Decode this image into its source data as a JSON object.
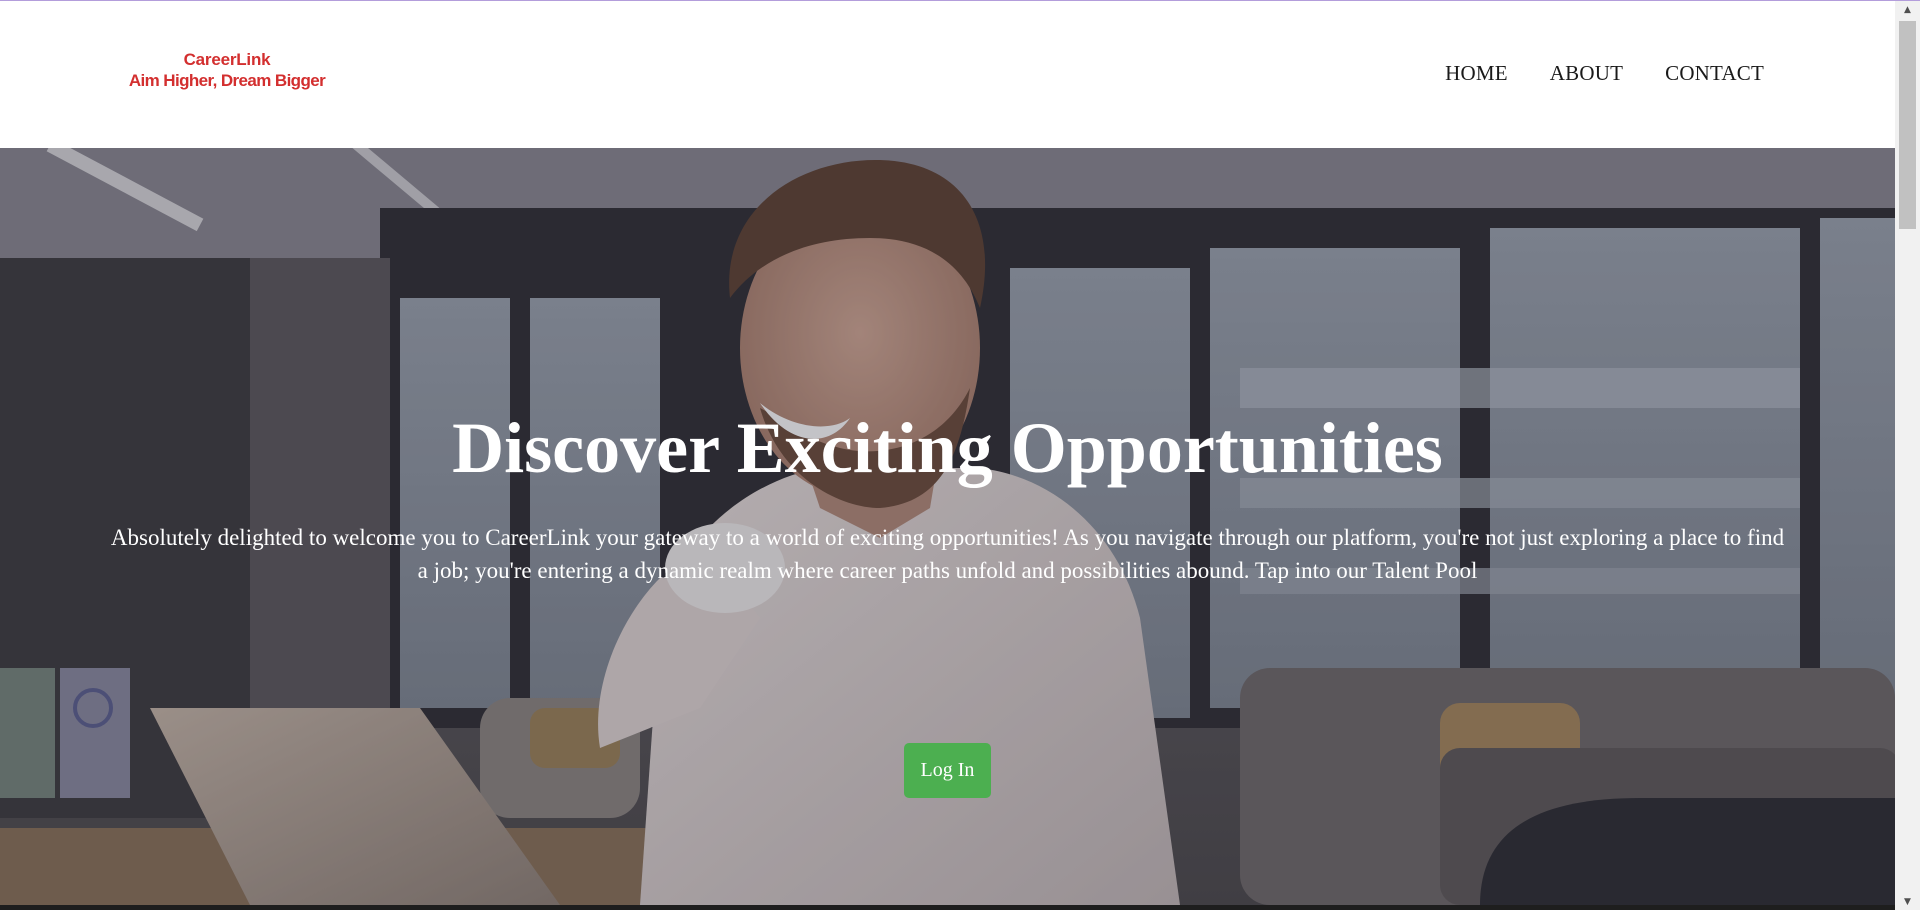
{
  "header": {
    "brand_name": "CareerLink",
    "tagline": "Aim Higher, Dream Bigger",
    "nav": [
      {
        "label": "HOME"
      },
      {
        "label": "ABOUT"
      },
      {
        "label": "CONTACT"
      }
    ]
  },
  "hero": {
    "title": "Discover Exciting Opportunities",
    "description": "Absolutely delighted to welcome you to CareerLink your gateway to a world of exciting opportunities! As you navigate through our platform, you're not just exploring a place to find a job; you're entering a dynamic realm where career paths unfold and possibilities abound. Tap into our Talent Pool",
    "login_label": "Log In"
  },
  "colors": {
    "brand": "#d32f2f",
    "button": "#4caf50",
    "nav_text": "#1a1a1a"
  },
  "icons": {
    "scroll_up": "scroll-up-arrow-icon",
    "scroll_down": "scroll-down-arrow-icon"
  }
}
